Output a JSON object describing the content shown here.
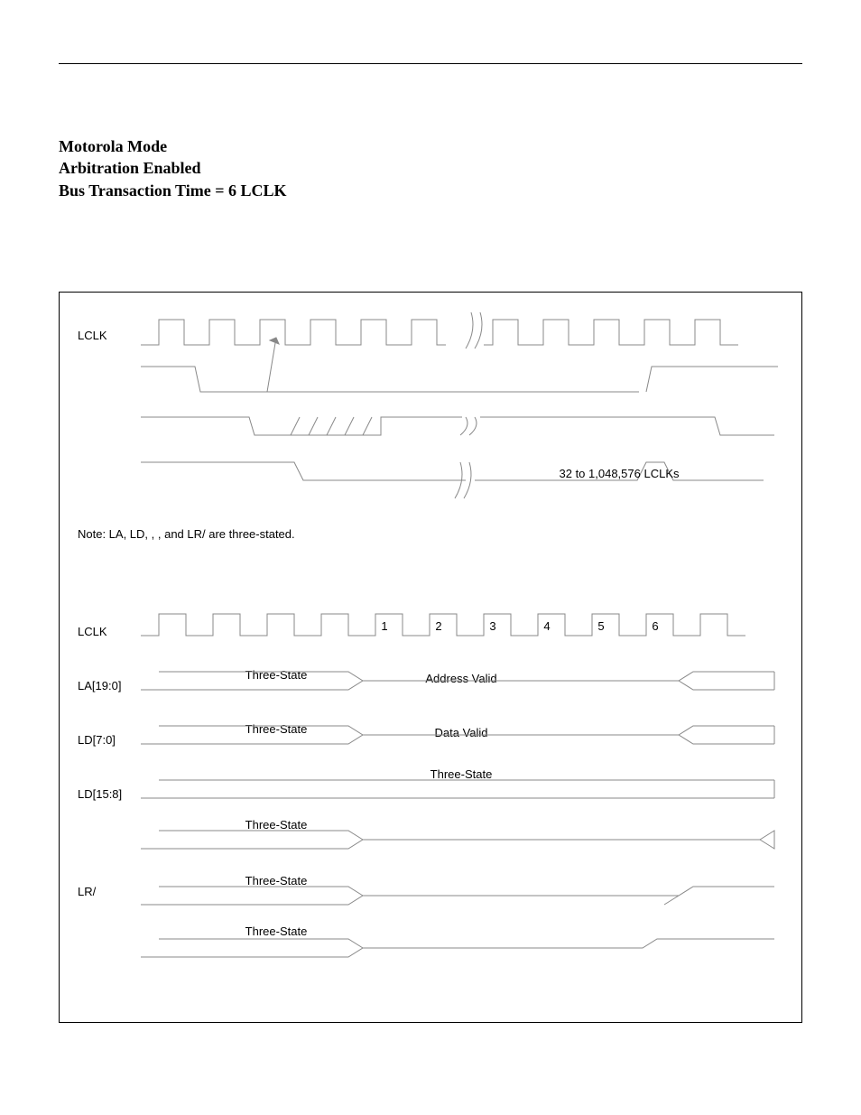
{
  "heading": {
    "line1": "Motorola Mode",
    "line2": "Arbitration Enabled",
    "line3": "Bus Transaction Time = 6 LCLK"
  },
  "top_diagram": {
    "signals": [
      "LCLK"
    ],
    "clk_range_label": "32 to 1,048,576 LCLKs",
    "note": "Note: LA, LD,       ,        , and LR/    are three-stated."
  },
  "bottom_diagram": {
    "signals": [
      "LCLK",
      "LA[19:0]",
      "LD[7:0]",
      "LD[15:8]",
      "",
      "LR/"
    ],
    "clk_numbers": [
      "1",
      "2",
      "3",
      "4",
      "5",
      "6"
    ],
    "la_states": {
      "left": "Three-State",
      "mid": "Address Valid"
    },
    "ld70_states": {
      "left": "Three-State",
      "mid": "Data Valid"
    },
    "ld158_state": "Three-State",
    "ts1": "Three-State",
    "lrw_state": "Three-State",
    "ts3": "Three-State"
  }
}
